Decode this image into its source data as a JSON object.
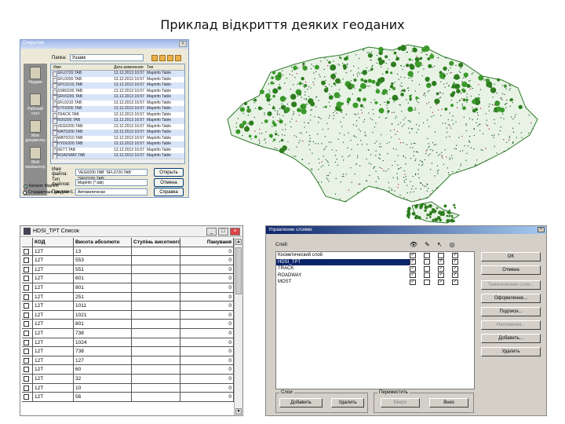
{
  "page": {
    "title": "Приклад відкриття деяких геоданих"
  },
  "open_dialog": {
    "title": "Открытие",
    "look_in_label": "Папка:",
    "look_in_value": "Ушавк",
    "places": [
      "Недавн",
      "Рабочий стол",
      "Мои документы",
      "Мой компьютер"
    ],
    "columns": [
      "Имя",
      "Дата изменения",
      "Тип"
    ],
    "files": [
      {
        "name": "SFL0720.TAB",
        "date": "13.12.2013 16:57",
        "type": "Mapinfo Table"
      },
      {
        "name": "SFL0200.TAB",
        "date": "13.12.2013 16:57",
        "type": "Mapinfo Table"
      },
      {
        "name": "SPC0210.TAB",
        "date": "13.12.2013 16:57",
        "type": "Mapinfo Table"
      },
      {
        "name": "SSR0200.TAB",
        "date": "13.12.2013 16:57",
        "type": "Mapinfo Table"
      },
      {
        "name": "SRV0200.TAB",
        "date": "13.12.2013 16:57",
        "type": "Mapinfo Table"
      },
      {
        "name": "SFL0210.TAB",
        "date": "13.12.2013 16:57",
        "type": "Mapinfo Table"
      },
      {
        "name": "STF0200.TAB",
        "date": "13.12.2013 16:57",
        "type": "Mapinfo Table"
      },
      {
        "name": "TRACK.TAB",
        "date": "13.12.2013 16:57",
        "type": "Mapinfo Table"
      },
      {
        "name": "RD0200.TAB",
        "date": "13.12.2013 16:57",
        "type": "Mapinfo Table"
      },
      {
        "name": "VEG0200.TAB",
        "date": "13.12.2013 16:57",
        "type": "Mapinfo Table"
      },
      {
        "name": "WAT0200.TAB",
        "date": "13.12.2013 16:57",
        "type": "Mapinfo Table"
      },
      {
        "name": "WAT0210.TAB",
        "date": "13.12.2013 16:57",
        "type": "Mapinfo Table"
      },
      {
        "name": "HYD0200.TAB",
        "date": "13.12.2013 16:57",
        "type": "Mapinfo Table"
      },
      {
        "name": "SETT.TAB",
        "date": "13.12.2013 16:57",
        "type": "Mapinfo Table"
      },
      {
        "name": "ROADWAY.TAB",
        "date": "13.12.2013 16:57",
        "type": "Mapinfo Table"
      }
    ],
    "filename_label": "Имя файла:",
    "filename_value": "'VEG0200.TAB' 'SFL0720.TAB' 'SRV0200.TAB'",
    "filetype_label": "Тип файлов:",
    "filetype_value": "MapInfo (*.tab)",
    "preferred_label": "Предпочт.:",
    "preferred_value": "Автоматически",
    "open_button": "Открыть",
    "cancel_button": "Отмена",
    "help_button": "Справка",
    "radio_1": "Каталог MapInfo",
    "radio_2": "Стандартные диалоги"
  },
  "table_window": {
    "title": "HDSI_TPT Список",
    "columns": [
      "КОД",
      "Висота абсолютн",
      "Ступінь висотного",
      "Пануваня"
    ],
    "rows": [
      [
        "12T",
        "13",
        "",
        "0"
      ],
      [
        "12T",
        "553",
        "",
        "0"
      ],
      [
        "12T",
        "551",
        "",
        "0"
      ],
      [
        "12T",
        "601",
        "",
        "0"
      ],
      [
        "12T",
        "801",
        "",
        "0"
      ],
      [
        "12T",
        "251",
        "",
        "0"
      ],
      [
        "12T",
        "1011",
        "",
        "0"
      ],
      [
        "12T",
        "1021",
        "",
        "0"
      ],
      [
        "12T",
        "801",
        "",
        "0"
      ],
      [
        "12T",
        "738",
        "",
        "0"
      ],
      [
        "12T",
        "1024",
        "",
        "0"
      ],
      [
        "12T",
        "738",
        "",
        "0"
      ],
      [
        "12T",
        "127",
        "",
        "0"
      ],
      [
        "12T",
        "60",
        "",
        "0"
      ],
      [
        "12T",
        "32",
        "",
        "0"
      ],
      [
        "12T",
        "10",
        "",
        "0"
      ],
      [
        "12T",
        "56",
        "",
        "0"
      ]
    ]
  },
  "layer_manager": {
    "title": "Управление слоями",
    "layer_header": "Слой:",
    "layers": [
      {
        "name": "Косметический слой",
        "checks": [
          true,
          false,
          false,
          true
        ],
        "selected": false
      },
      {
        "name": "HDSI_TPT",
        "checks": [
          true,
          false,
          true,
          true
        ],
        "selected": true
      },
      {
        "name": "TRACK",
        "checks": [
          true,
          false,
          true,
          true
        ],
        "selected": false
      },
      {
        "name": "ROADWAY",
        "checks": [
          true,
          false,
          true,
          true
        ],
        "selected": false
      },
      {
        "name": "MOST",
        "checks": [
          true,
          false,
          true,
          true
        ],
        "selected": false
      }
    ],
    "buttons": [
      "OK",
      "Отмена",
      "Тематические слои...",
      "Оформление...",
      "Подписи...",
      "Наложения...",
      "Добавить...",
      "Удалить"
    ],
    "disabled_buttons": [
      2,
      5
    ],
    "group_layers": "Слои",
    "group_move": "Переместить",
    "add_button": "Добавить",
    "delete_button": "Удалить",
    "up_button": "Вверх",
    "down_button": "Вниз"
  }
}
